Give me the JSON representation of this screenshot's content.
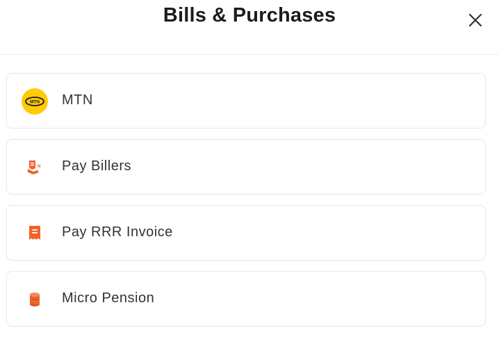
{
  "header": {
    "title": "Bills & Purchases"
  },
  "items": [
    {
      "label": "MTN",
      "icon": "mtn-logo-icon"
    },
    {
      "label": "Pay Billers",
      "icon": "receipt-hand-icon"
    },
    {
      "label": "Pay RRR Invoice",
      "icon": "invoice-icon"
    },
    {
      "label": "Micro Pension",
      "icon": "coins-icon"
    }
  ],
  "colors": {
    "accent": "#f0622a",
    "mtn_yellow": "#ffcb05",
    "border": "#e6e6e6",
    "text": "#333333"
  }
}
